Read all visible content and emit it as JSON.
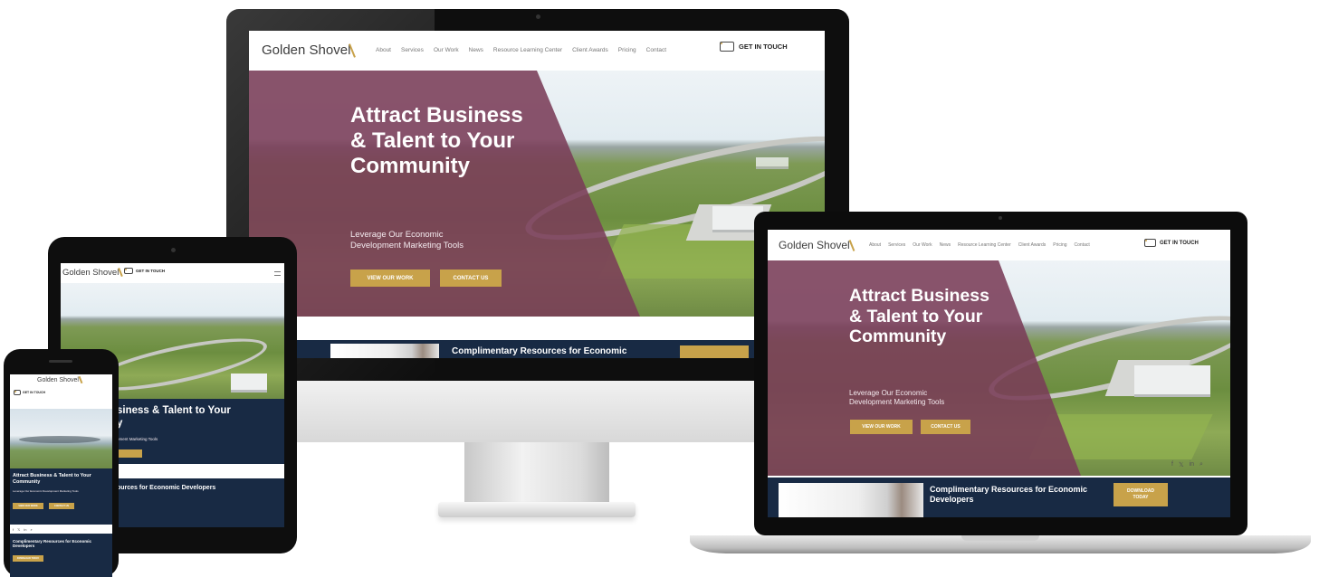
{
  "brand": {
    "logo": "Golden Shovel",
    "gold": "#c8a24a",
    "plum": "#7a3c58",
    "navy": "#182a44"
  },
  "nav": [
    "About",
    "Services",
    "Our Work",
    "News",
    "Resource Learning Center",
    "Client Awards",
    "Pricing",
    "Contact"
  ],
  "cta": "GET IN TOUCH",
  "hero": {
    "title": "Attract Business & Talent to Your Community",
    "subtitle": "Leverage Our Economic Development Marketing Tools",
    "btn_work": "VIEW OUR WORK",
    "btn_contact": "CONTACT US"
  },
  "tablet": {
    "hero_partial": "siness & Talent to Your",
    "hero_partial2": "y",
    "sub_partial": "pment Marketing Tools",
    "resources_partial": "ources for Economic Developers"
  },
  "resources": {
    "title": "Complimentary Resources for Economic Developers",
    "title_cut": "Complimentary Resources for Economic",
    "download": "DOWNLOAD TODAY"
  },
  "social_icons": [
    "facebook-icon",
    "twitter-icon",
    "linkedin-icon",
    "search-icon"
  ]
}
